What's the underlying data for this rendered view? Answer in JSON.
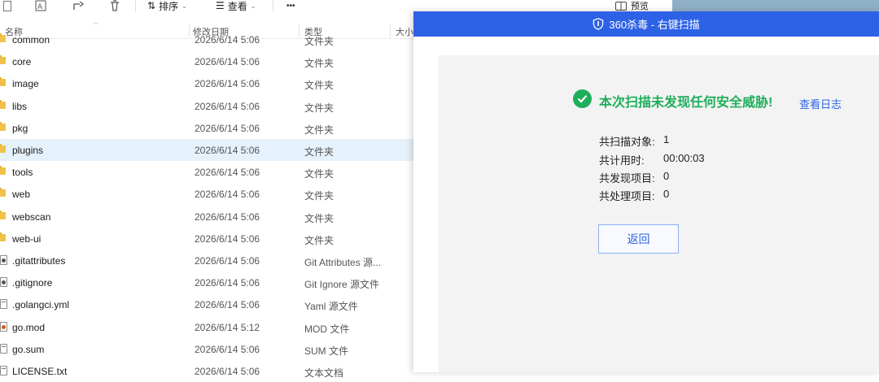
{
  "toolbar": {
    "sort_label": "排序",
    "view_label": "查看",
    "more_label": "•••",
    "preview_label": "预览"
  },
  "columns": {
    "name": "名称",
    "date": "修改日期",
    "type": "类型",
    "size": "大小"
  },
  "files": [
    {
      "name": "common",
      "date": "2026/6/14 5:06",
      "type": "文件夹",
      "kind": "folder"
    },
    {
      "name": "core",
      "date": "2026/6/14 5:06",
      "type": "文件夹",
      "kind": "folder"
    },
    {
      "name": "image",
      "date": "2026/6/14 5:06",
      "type": "文件夹",
      "kind": "folder"
    },
    {
      "name": "libs",
      "date": "2026/6/14 5:06",
      "type": "文件夹",
      "kind": "folder"
    },
    {
      "name": "pkg",
      "date": "2026/6/14 5:06",
      "type": "文件夹",
      "kind": "folder"
    },
    {
      "name": "plugins",
      "date": "2026/6/14 5:06",
      "type": "文件夹",
      "kind": "folder",
      "selected": true
    },
    {
      "name": "tools",
      "date": "2026/6/14 5:06",
      "type": "文件夹",
      "kind": "folder"
    },
    {
      "name": "web",
      "date": "2026/6/14 5:06",
      "type": "文件夹",
      "kind": "folder"
    },
    {
      "name": "webscan",
      "date": "2026/6/14 5:06",
      "type": "文件夹",
      "kind": "folder"
    },
    {
      "name": "web-ui",
      "date": "2026/6/14 5:06",
      "type": "文件夹",
      "kind": "folder"
    },
    {
      "name": ".gitattributes",
      "date": "2026/6/14 5:06",
      "type": "Git Attributes 源...",
      "kind": "git"
    },
    {
      "name": ".gitignore",
      "date": "2026/6/14 5:06",
      "type": "Git Ignore 源文件",
      "kind": "git"
    },
    {
      "name": ".golangci.yml",
      "date": "2026/6/14 5:06",
      "type": "Yaml 源文件",
      "kind": "yaml"
    },
    {
      "name": "go.mod",
      "date": "2026/6/14 5:12",
      "type": "MOD 文件",
      "kind": "mod"
    },
    {
      "name": "go.sum",
      "date": "2026/6/14 5:06",
      "type": "SUM 文件",
      "kind": "plain"
    },
    {
      "name": "LICENSE.txt",
      "date": "2026/6/14 5:06",
      "type": "文本文档",
      "kind": "plain"
    }
  ],
  "dialog": {
    "title": "360杀毒 - 右键扫描",
    "result": "本次扫描未发现任何安全威胁!",
    "log_link": "查看日志",
    "stats": [
      {
        "label": "共扫描对象:",
        "value": "1"
      },
      {
        "label": "共计用时:",
        "value": "00:00:03"
      },
      {
        "label": "共发现项目:",
        "value": "0"
      },
      {
        "label": "共处理项目:",
        "value": "0"
      }
    ],
    "back_label": "返回"
  },
  "colors": {
    "title_bar": "#2e62e6",
    "success": "#1fae5a",
    "link": "#2e62e6",
    "selected_row": "#e5f1fb",
    "folder": "#f0c24b"
  }
}
